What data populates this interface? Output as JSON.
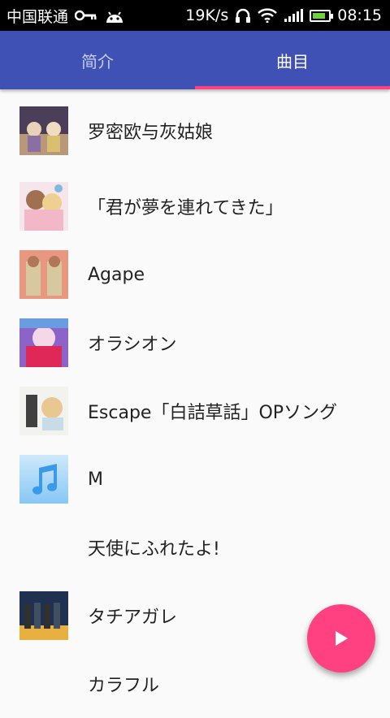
{
  "status_bar": {
    "carrier": "中国联通",
    "speed": "19K/s",
    "time": "08:15"
  },
  "tabs": [
    {
      "label": "简介",
      "active": false
    },
    {
      "label": "曲目",
      "active": true
    }
  ],
  "tracks": [
    {
      "title": "罗密欧与灰姑娘",
      "art": "album-art-1"
    },
    {
      "title": "「君が夢を連れてきた」",
      "art": "album-art-2"
    },
    {
      "title": "Agape",
      "art": "album-art-3"
    },
    {
      "title": "オラシオン",
      "art": "album-art-4"
    },
    {
      "title": "Escape「白詰草話」OPソング",
      "art": "album-art-5"
    },
    {
      "title": "M",
      "art": "music-note-placeholder"
    },
    {
      "title": "天使にふれたよ!",
      "art": "none"
    },
    {
      "title": "タチアガレ",
      "art": "album-art-8"
    },
    {
      "title": "カラフル",
      "art": "none"
    }
  ],
  "colors": {
    "primary": "#3f51b5",
    "accent": "#ff4081"
  }
}
